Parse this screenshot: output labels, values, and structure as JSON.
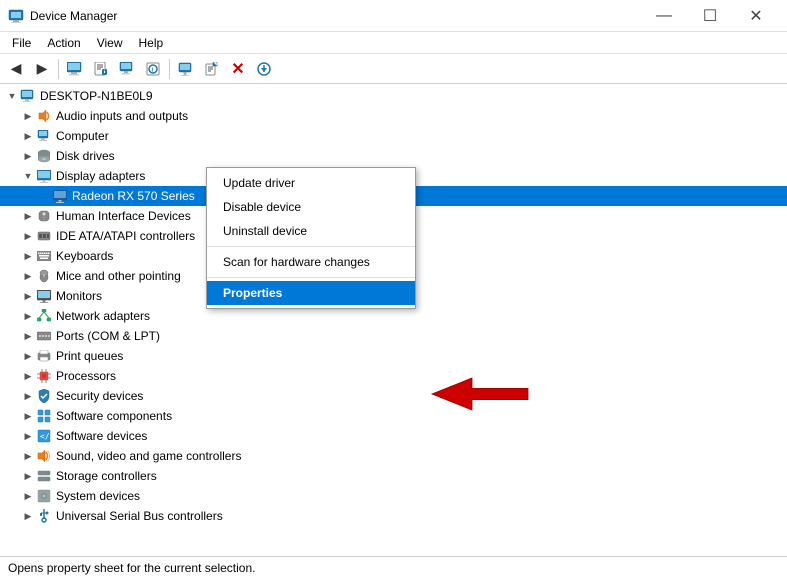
{
  "titleBar": {
    "title": "Device Manager",
    "iconLabel": "device-manager-icon",
    "buttons": {
      "minimize": "—",
      "maximize": "☐",
      "close": "✕"
    }
  },
  "menuBar": {
    "items": [
      "File",
      "Action",
      "View",
      "Help"
    ]
  },
  "toolbar": {
    "buttons": [
      {
        "name": "back-btn",
        "icon": "◀",
        "disabled": false
      },
      {
        "name": "forward-btn",
        "icon": "▶",
        "disabled": false
      },
      {
        "name": "properties-tb-btn",
        "icon": "🖥",
        "disabled": false
      },
      {
        "name": "update-driver-tb-btn",
        "icon": "📋",
        "disabled": false
      },
      {
        "name": "help-tb-btn",
        "icon": "?",
        "disabled": false
      },
      {
        "name": "scan-tb-btn",
        "icon": "🖨",
        "disabled": false
      },
      {
        "name": "delete-tb-btn",
        "icon": "✕",
        "disabled": false
      },
      {
        "name": "arrow-down-tb-btn",
        "icon": "⬇",
        "disabled": false
      }
    ]
  },
  "tree": {
    "root": "DESKTOP-N1BE0L9",
    "items": [
      {
        "label": "DESKTOP-N1BE0L9",
        "indent": 0,
        "hasArrow": true,
        "arrowType": "expanded",
        "iconType": "computer",
        "id": "root"
      },
      {
        "label": "Audio inputs and outputs",
        "indent": 1,
        "hasArrow": true,
        "arrowType": "collapsed",
        "iconType": "audio",
        "id": "audio"
      },
      {
        "label": "Computer",
        "indent": 1,
        "hasArrow": true,
        "arrowType": "collapsed",
        "iconType": "computer-small",
        "id": "computer"
      },
      {
        "label": "Disk drives",
        "indent": 1,
        "hasArrow": true,
        "arrowType": "collapsed",
        "iconType": "disk",
        "id": "disk"
      },
      {
        "label": "Display adapters",
        "indent": 1,
        "hasArrow": true,
        "arrowType": "expanded",
        "iconType": "display",
        "id": "display"
      },
      {
        "label": "Radeon RX 570 Series",
        "indent": 2,
        "hasArrow": false,
        "arrowType": "none",
        "iconType": "display-small",
        "id": "radeon",
        "selected": true
      },
      {
        "label": "Human Interface Devices",
        "indent": 1,
        "hasArrow": true,
        "arrowType": "collapsed",
        "iconType": "hid",
        "id": "hid"
      },
      {
        "label": "IDE ATA/ATAPI controllers",
        "indent": 1,
        "hasArrow": true,
        "arrowType": "collapsed",
        "iconType": "ide",
        "id": "ide"
      },
      {
        "label": "Keyboards",
        "indent": 1,
        "hasArrow": true,
        "arrowType": "collapsed",
        "iconType": "keyboard",
        "id": "keyboard"
      },
      {
        "label": "Mice and other pointing",
        "indent": 1,
        "hasArrow": true,
        "arrowType": "collapsed",
        "iconType": "mouse",
        "id": "mice"
      },
      {
        "label": "Monitors",
        "indent": 1,
        "hasArrow": true,
        "arrowType": "collapsed",
        "iconType": "monitor",
        "id": "monitors"
      },
      {
        "label": "Network adapters",
        "indent": 1,
        "hasArrow": true,
        "arrowType": "collapsed",
        "iconType": "network",
        "id": "network"
      },
      {
        "label": "Ports (COM & LPT)",
        "indent": 1,
        "hasArrow": true,
        "arrowType": "collapsed",
        "iconType": "ports",
        "id": "ports"
      },
      {
        "label": "Print queues",
        "indent": 1,
        "hasArrow": true,
        "arrowType": "collapsed",
        "iconType": "print",
        "id": "print"
      },
      {
        "label": "Processors",
        "indent": 1,
        "hasArrow": true,
        "arrowType": "collapsed",
        "iconType": "processor",
        "id": "processors"
      },
      {
        "label": "Security devices",
        "indent": 1,
        "hasArrow": true,
        "arrowType": "collapsed",
        "iconType": "security",
        "id": "security"
      },
      {
        "label": "Software components",
        "indent": 1,
        "hasArrow": true,
        "arrowType": "collapsed",
        "iconType": "software",
        "id": "softwarecomp"
      },
      {
        "label": "Software devices",
        "indent": 1,
        "hasArrow": true,
        "arrowType": "collapsed",
        "iconType": "software",
        "id": "softwaredev"
      },
      {
        "label": "Sound, video and game controllers",
        "indent": 1,
        "hasArrow": true,
        "arrowType": "collapsed",
        "iconType": "sound",
        "id": "sound"
      },
      {
        "label": "Storage controllers",
        "indent": 1,
        "hasArrow": true,
        "arrowType": "collapsed",
        "iconType": "storage",
        "id": "storage"
      },
      {
        "label": "System devices",
        "indent": 1,
        "hasArrow": true,
        "arrowType": "collapsed",
        "iconType": "system",
        "id": "system"
      },
      {
        "label": "Universal Serial Bus controllers",
        "indent": 1,
        "hasArrow": true,
        "arrowType": "collapsed",
        "iconType": "usb",
        "id": "usb"
      }
    ]
  },
  "contextMenu": {
    "items": [
      {
        "label": "Update driver",
        "type": "item",
        "id": "update-driver"
      },
      {
        "label": "Disable device",
        "type": "item",
        "id": "disable-device"
      },
      {
        "label": "Uninstall device",
        "type": "item",
        "id": "uninstall-device"
      },
      {
        "type": "separator"
      },
      {
        "label": "Scan for hardware changes",
        "type": "item",
        "id": "scan-hardware"
      },
      {
        "type": "separator"
      },
      {
        "label": "Properties",
        "type": "item",
        "id": "properties",
        "highlighted": true
      }
    ]
  },
  "statusBar": {
    "text": "Opens property sheet for the current selection."
  },
  "icons": {
    "computer": "🖥",
    "audio": "🔊",
    "disk": "💾",
    "display": "🖥",
    "keyboard": "⌨",
    "mouse": "🖱",
    "network": "🌐",
    "processor": "⚙",
    "usb": "🔌",
    "generic": "📦"
  }
}
